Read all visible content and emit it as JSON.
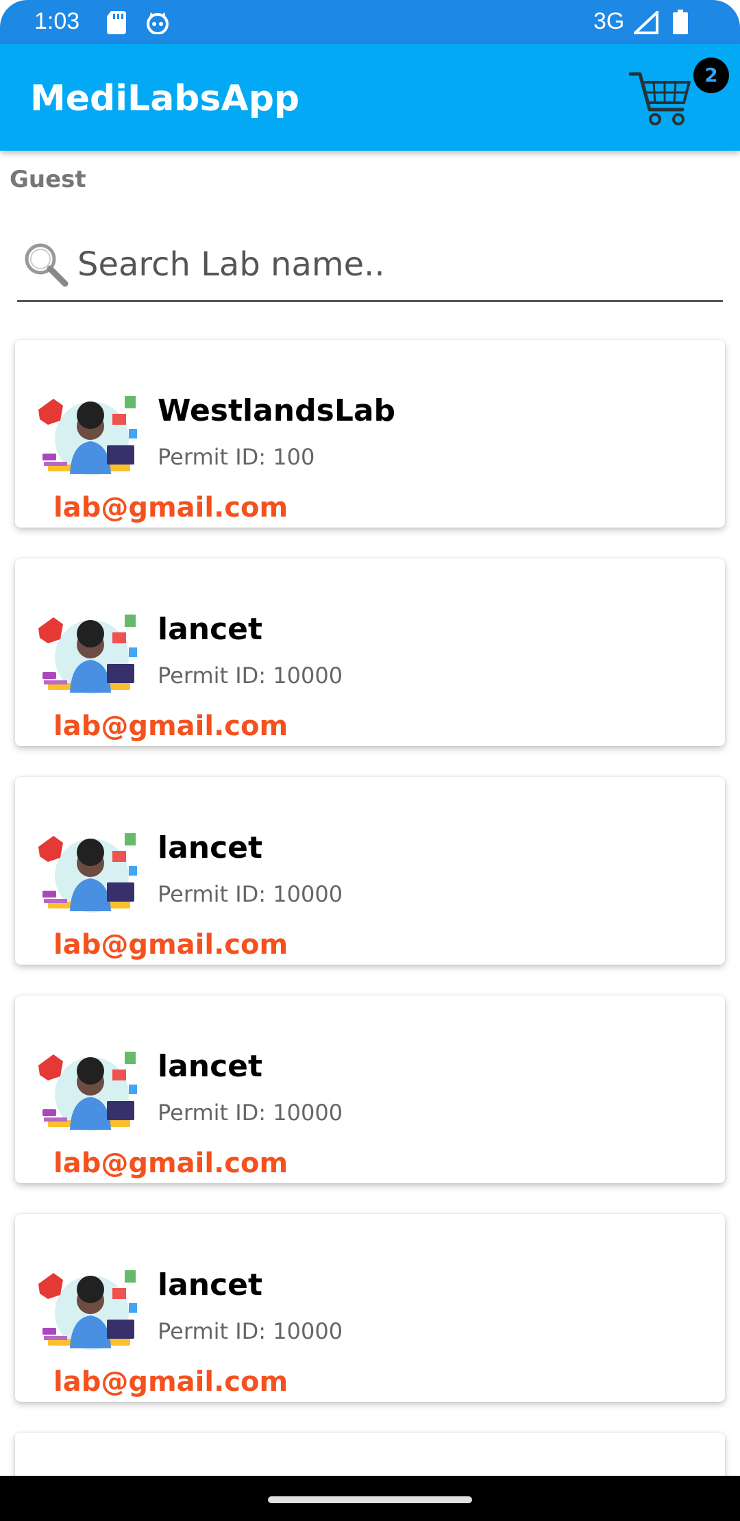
{
  "status_bar": {
    "time": "1:03",
    "network": "3G",
    "icons": [
      "sd-card-icon",
      "cat-icon",
      "signal-icon",
      "battery-icon"
    ]
  },
  "app_bar": {
    "title": "MediLabsApp",
    "cart_badge_count": "2",
    "icons": [
      "cart-icon"
    ],
    "colors": {
      "background": "#03a9f4",
      "status_bar": "#1e88e5"
    }
  },
  "user": {
    "label": "Guest"
  },
  "search": {
    "placeholder": "Search Lab name..",
    "value": ""
  },
  "labs": [
    {
      "name": "WestlandsLab",
      "permit": "Permit ID: 100",
      "email": "lab@gmail.com"
    },
    {
      "name": "lancet",
      "permit": "Permit ID: 10000",
      "email": "lab@gmail.com"
    },
    {
      "name": "lancet",
      "permit": "Permit ID: 10000",
      "email": "lab@gmail.com"
    },
    {
      "name": "lancet",
      "permit": "Permit ID: 10000",
      "email": "lab@gmail.com"
    },
    {
      "name": "lancet",
      "permit": "Permit ID: 10000",
      "email": "lab@gmail.com"
    }
  ],
  "colors": {
    "email": "#f4511e",
    "permit": "#666666"
  }
}
